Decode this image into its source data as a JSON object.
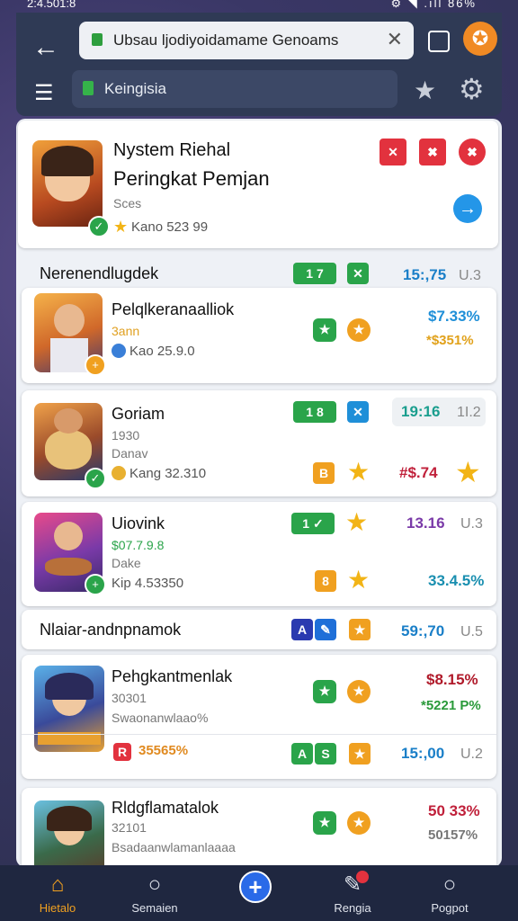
{
  "status": {
    "time": "2:4.501:8",
    "right": "⚙ ◥ .ıll 86%"
  },
  "browser": {
    "url": "Ubsau ljodiyoidamame Genoams",
    "search": "Keingisia",
    "close_glyph": "✕",
    "back_glyph": "←",
    "menu_glyph": "☰",
    "star_glyph": "★",
    "gear_glyph": "⚙",
    "orange_glyph": "✪"
  },
  "header_card": {
    "line1": "Nystem Riehal",
    "title": "Peringkat Pemjan",
    "subtitle": "Sces",
    "rating": "Kano 523 99",
    "icon_glyph": "✪",
    "x1": "✕",
    "x2": "✖",
    "x3": "✖",
    "arrow": "→"
  },
  "section1": {
    "title": "Nerenendlugdek",
    "num": "15:,75",
    "gray": "U.3",
    "b1": "1",
    "b2": "7"
  },
  "rows": [
    {
      "name": "Pelqlkeranaalliok",
      "sub": "3ann",
      "meta": "Kao 25.9.0",
      "val1": "$7.33%",
      "val2": "*$351%",
      "c1": "#1f8fd8",
      "c2": "#e1a11a"
    },
    {
      "name": "Goriam",
      "sub": "1930",
      "sub2": "Danav",
      "meta": "Kang 32.310",
      "val1": "19:16",
      "gray": "1I.2",
      "val2": "#$.74",
      "c1": "#1a9e8e",
      "c2": "#c0203a",
      "b1": "1",
      "b2": "8"
    },
    {
      "name": "Uiovink",
      "sub": "$07.7.9.8",
      "sub2": "Dake",
      "meta": "Kip 4.53350",
      "val1": "13.16",
      "gray": "U.3",
      "val2": "33.4.5%",
      "c1": "#7a3aa8",
      "c2": "#1a8fb0",
      "b1": "1"
    }
  ],
  "section2": {
    "title": "Nlaiar-andnpnamok",
    "num": "59:,70",
    "gray": "U.5"
  },
  "rows2": [
    {
      "name": "Pehgkantmenlak",
      "sub": "30301",
      "sub2": "Swaonanwlaao%",
      "val1": "$8.15%",
      "val2": "*5221 P%",
      "badge": "R",
      "badge_text": "35565%",
      "num": "15:,00",
      "gray": "U.2",
      "c1": "#b01a2a",
      "c2": "#2a9a3a"
    },
    {
      "name": "Rldgflamatalok",
      "sub": "32101",
      "sub2": "Bsadaanwlamanlaaaa",
      "val1": "50 33%",
      "val2": "50157%",
      "c1": "#c0203a",
      "c2": "#777777"
    }
  ],
  "nav": [
    {
      "label": "Hietalo",
      "icon": "⌂"
    },
    {
      "label": "Semaien",
      "icon": "○"
    },
    {
      "label": "",
      "icon": "+"
    },
    {
      "label": "Rengia",
      "icon": "✎"
    },
    {
      "label": "Pogpot",
      "icon": "○"
    }
  ],
  "colors": {
    "accent_green": "#2aa44a",
    "accent_orange": "#f0a020",
    "accent_red": "#e2323e",
    "nav_bg": "#1f2740"
  }
}
